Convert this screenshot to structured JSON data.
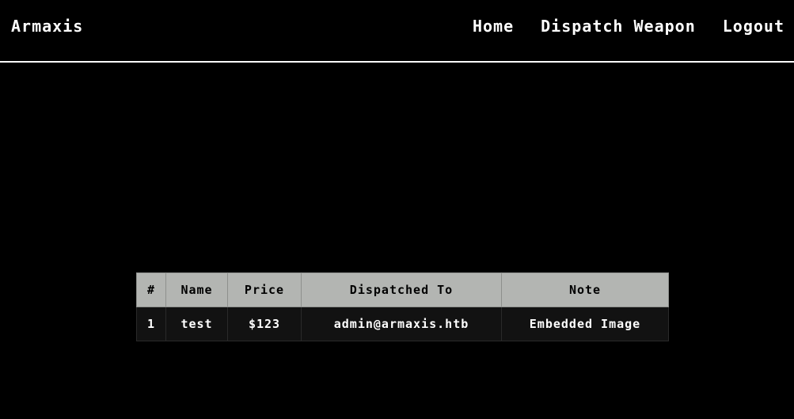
{
  "navbar": {
    "brand": "Armaxis",
    "links": [
      {
        "label": "Home"
      },
      {
        "label": "Dispatch Weapon"
      },
      {
        "label": "Logout"
      }
    ]
  },
  "table": {
    "headers": [
      "#",
      "Name",
      "Price",
      "Dispatched To",
      "Note"
    ],
    "rows": [
      [
        "1",
        "test",
        "$123",
        "admin@armaxis.htb",
        "Embedded Image"
      ]
    ]
  }
}
